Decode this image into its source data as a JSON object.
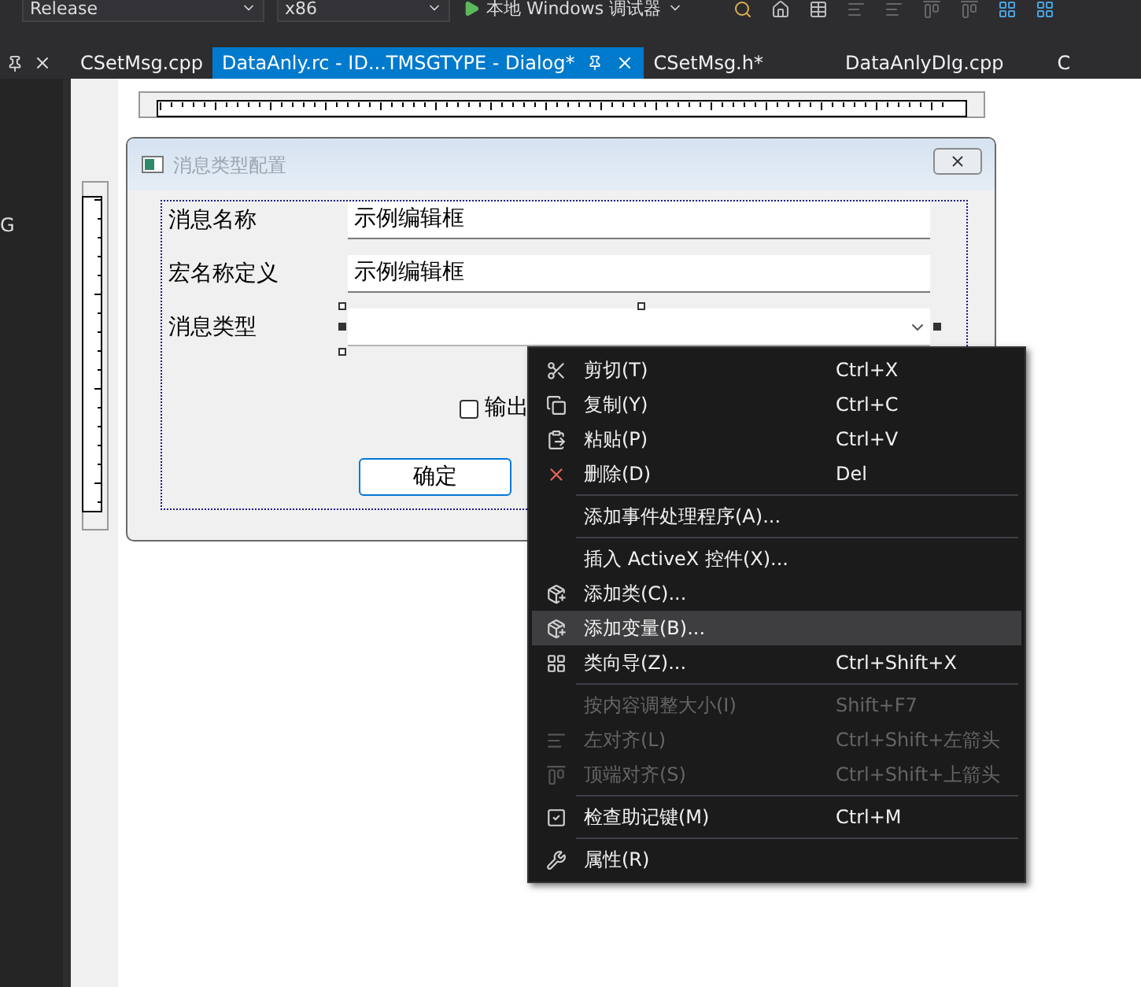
{
  "toolbar": {
    "configuration": "Release",
    "platform": "x86",
    "debugger": "本地 Windows 调试器"
  },
  "tabs": [
    {
      "label": "CSetMsg.cpp",
      "selected": false
    },
    {
      "label": "DataAnly.rc - ID...TMSGTYPE - Dialog*",
      "selected": true
    },
    {
      "label": "CSetMsg.h*",
      "selected": false
    },
    {
      "label": "DataAnlyDlg.cpp",
      "selected": false
    },
    {
      "label": "C",
      "selected": false
    }
  ],
  "left_panel": {
    "text": "G"
  },
  "dialog": {
    "title": "消息类型配置",
    "fields": [
      {
        "label": "消息名称",
        "kind": "edit",
        "value": "示例编辑框"
      },
      {
        "label": "宏名称定义",
        "kind": "edit",
        "value": "示例编辑框"
      },
      {
        "label": "消息类型",
        "kind": "combo",
        "selected": true
      }
    ],
    "checkbox": {
      "label": "输出",
      "checked": false
    },
    "button": "确定"
  },
  "context_menu": [
    {
      "kind": "item",
      "label": "剪切(T)",
      "shortcut": "Ctrl+X",
      "disabled": false,
      "selected": false
    },
    {
      "kind": "item",
      "label": "复制(Y)",
      "shortcut": "Ctrl+C",
      "disabled": false,
      "selected": false
    },
    {
      "kind": "item",
      "label": "粘贴(P)",
      "shortcut": "Ctrl+V",
      "disabled": false,
      "selected": false
    },
    {
      "kind": "item",
      "label": "删除(D)",
      "shortcut": "Del",
      "disabled": false,
      "selected": false
    },
    {
      "kind": "separator"
    },
    {
      "kind": "item",
      "label": "添加事件处理程序(A)...",
      "disabled": false,
      "selected": false
    },
    {
      "kind": "separator"
    },
    {
      "kind": "item",
      "label": "插入 ActiveX 控件(X)...",
      "disabled": false,
      "selected": false
    },
    {
      "kind": "item",
      "label": "添加类(C)...",
      "disabled": false,
      "selected": false
    },
    {
      "kind": "item",
      "label": "添加变量(B)...",
      "disabled": false,
      "selected": true
    },
    {
      "kind": "item",
      "label": "类向导(Z)...",
      "shortcut": "Ctrl+Shift+X",
      "disabled": false,
      "selected": false
    },
    {
      "kind": "separator"
    },
    {
      "kind": "item",
      "label": "按内容调整大小(I)",
      "shortcut": "Shift+F7",
      "disabled": true,
      "selected": false
    },
    {
      "kind": "item",
      "label": "左对齐(L)",
      "shortcut": "Ctrl+Shift+左箭头",
      "disabled": true,
      "selected": false
    },
    {
      "kind": "item",
      "label": "顶端对齐(S)",
      "shortcut": "Ctrl+Shift+上箭头",
      "disabled": true,
      "selected": false
    },
    {
      "kind": "separator"
    },
    {
      "kind": "item",
      "label": "检查助记键(M)",
      "shortcut": "Ctrl+M",
      "disabled": false,
      "selected": false
    },
    {
      "kind": "separator"
    },
    {
      "kind": "item",
      "label": "属性(R)",
      "disabled": false,
      "selected": false
    }
  ]
}
